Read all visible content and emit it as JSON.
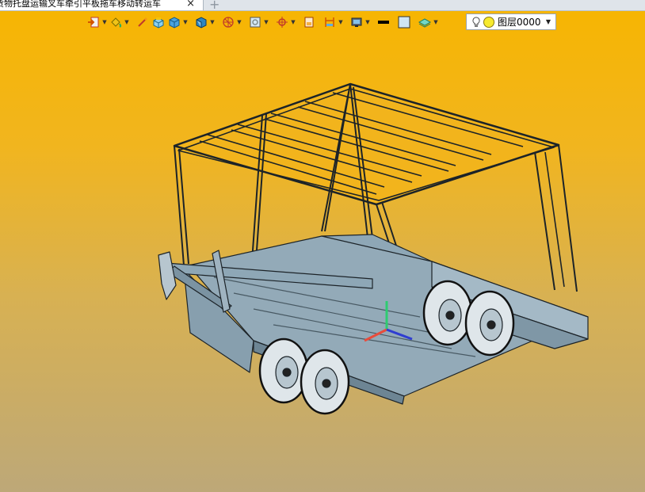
{
  "tab": {
    "title": "货物托盘运输叉车牵引平板拖车移动转运车",
    "close_icon": "×",
    "new_tab_icon": "+"
  },
  "toolbar": {
    "buttons": [
      "exit-icon",
      "paint-bucket-icon",
      "brush-icon",
      "solid-box-icon",
      "cube-icon",
      "view-cube-icon",
      "sphere-wireframe-icon",
      "zoom-fit-icon",
      "target-icon",
      "sheet-icon",
      "dimension-icon",
      "display-mode-icon",
      "line-color-swatch",
      "fill-color-swatch",
      "layer-stack-icon"
    ]
  },
  "layer": {
    "name": "图层0000"
  },
  "colors": {
    "accent_top": "#f7b500",
    "accent_bottom": "#bda878",
    "model_fill": "#8fa5b3",
    "model_stroke": "#1c2328"
  }
}
